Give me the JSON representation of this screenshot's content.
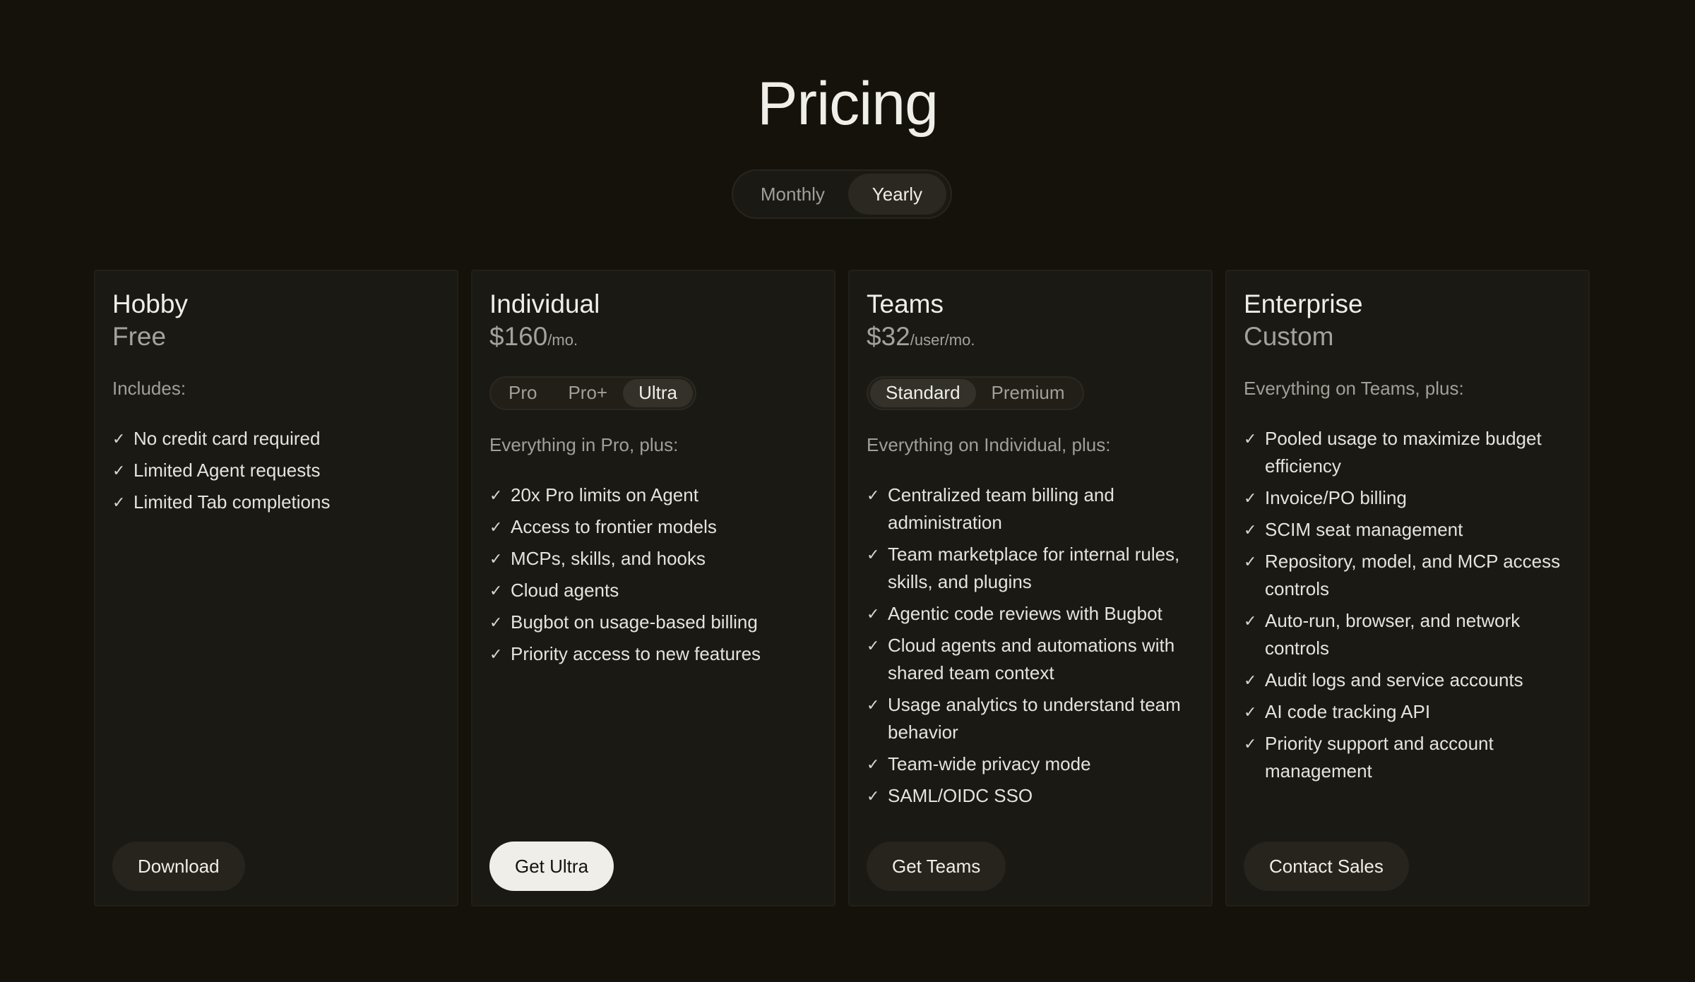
{
  "page": {
    "title": "Pricing",
    "billing": {
      "options": [
        "Monthly",
        "Yearly"
      ],
      "selected": "Yearly"
    }
  },
  "plans": [
    {
      "name": "Hobby",
      "price": "Free",
      "unit": "",
      "includes_label": "Includes:",
      "features": [
        "No credit card required",
        "Limited Agent requests",
        "Limited Tab completions"
      ],
      "cta": "Download"
    },
    {
      "name": "Individual",
      "price": "$160",
      "unit": "/mo.",
      "tiers": [
        "Pro",
        "Pro+",
        "Ultra"
      ],
      "selected_tier": "Ultra",
      "includes_label": "Everything in Pro, plus:",
      "features": [
        "20x Pro limits on Agent",
        "Access to frontier models",
        "MCPs, skills, and hooks",
        "Cloud agents",
        "Bugbot on usage-based billing",
        "Priority access to new features"
      ],
      "cta": "Get Ultra"
    },
    {
      "name": "Teams",
      "price": "$32",
      "unit": "/user/mo.",
      "tiers": [
        "Standard",
        "Premium"
      ],
      "selected_tier": "Standard",
      "includes_label": "Everything on Individual, plus:",
      "features": [
        "Centralized team billing and administration",
        "Team marketplace for internal rules, skills, and plugins",
        "Agentic code reviews with Bugbot",
        "Cloud agents and automations with shared team context",
        "Usage analytics to understand team behavior",
        "Team-wide privacy mode",
        "SAML/OIDC SSO"
      ],
      "cta": "Get Teams"
    },
    {
      "name": "Enterprise",
      "price": "Custom",
      "unit": "",
      "includes_label": "Everything on Teams, plus:",
      "features": [
        "Pooled usage to maximize budget efficiency",
        "Invoice/PO billing",
        "SCIM seat management",
        "Repository, model, and MCP access controls",
        "Auto-run, browser, and network controls",
        "Audit logs and service accounts",
        "AI code tracking API",
        "Priority support and account management"
      ],
      "cta": "Contact Sales"
    }
  ],
  "icons": {
    "feature_bullet": "check-icon",
    "check_glyph": "✓"
  },
  "colors": {
    "background": "#14120b",
    "card": "#1b1913",
    "primary_button": "#efeee9"
  }
}
